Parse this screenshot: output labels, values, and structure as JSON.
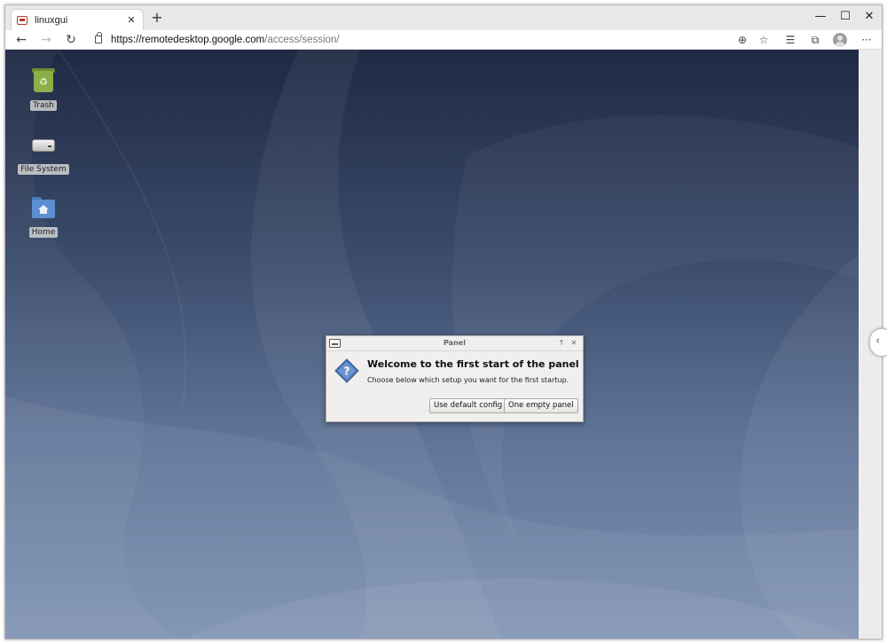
{
  "browser": {
    "tab": {
      "title": "linuxgui",
      "close": "✕"
    },
    "new_tab": "+",
    "window_controls": {
      "minimize": "—",
      "maximize": "☐",
      "close": "✕"
    },
    "nav": {
      "back": "←",
      "forward": "→",
      "reload": "↻"
    },
    "url": {
      "host": "https://remotedesktop.google.com",
      "path": "/access/session/"
    },
    "toolbar_icons": {
      "add": "⊕",
      "favorite": "☆",
      "favorites": "☰",
      "collections": "⧉",
      "more": "···"
    }
  },
  "desktop": {
    "icons": [
      {
        "label": "Trash"
      },
      {
        "label": "File System"
      },
      {
        "label": "Home"
      }
    ],
    "trash_symbol": "♻",
    "side_handle": "‹"
  },
  "dialog": {
    "title": "Panel",
    "title_buttons": {
      "pin": "↑",
      "close": "✕"
    },
    "heading": "Welcome to the first start of the panel",
    "message": "Choose below which setup you want for the first startup.",
    "buttons": {
      "default": "Use default config",
      "empty": "One empty panel"
    }
  },
  "colors": {
    "desktop_top": "#1f2a44",
    "desktop_bottom": "#7e92b3",
    "dialog_bg": "#f0efed",
    "question_icon": "#4f78b8"
  }
}
